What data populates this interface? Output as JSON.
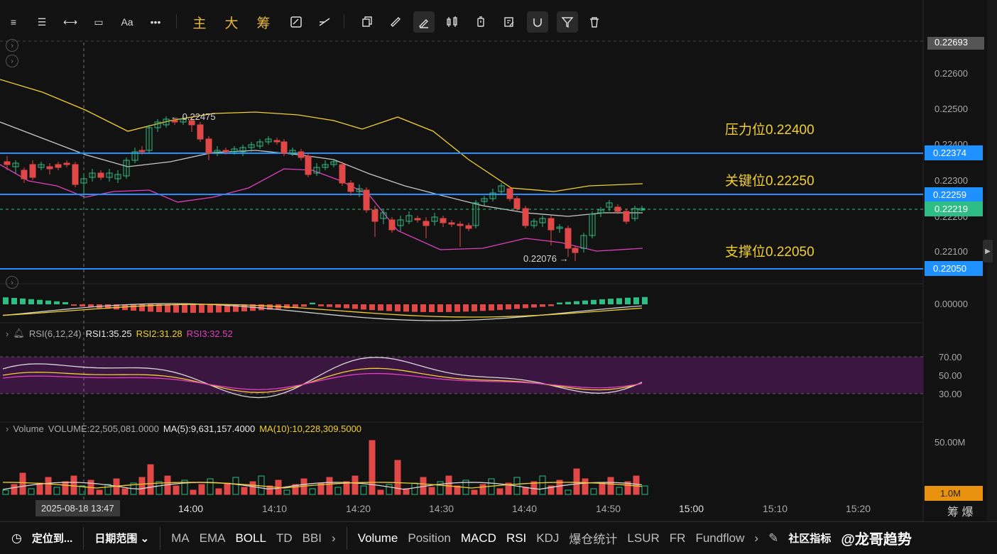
{
  "toolbar": {
    "items": [
      "≡",
      "☰",
      "⟷",
      "▭",
      "Aa",
      "•••"
    ],
    "cn": [
      "主",
      "大",
      "筹"
    ]
  },
  "price_axis": {
    "labels": [
      "0.22600",
      "0.22500",
      "0.22400",
      "0.22300",
      "0.22200",
      "0.22100"
    ],
    "top_tag": "0.22693",
    "macd_zero": "0.00000",
    "rsi_labels": [
      "70.00",
      "50.00",
      "30.00"
    ],
    "vol_top": "50.00M",
    "vol_tag": "1.0M"
  },
  "price_tags": {
    "resistance_line": "0.22374",
    "key_line": "0.22259",
    "current": "0.22219",
    "support_line": "0.22050"
  },
  "annotations": {
    "resistance": "压力位0.22400",
    "key": "关键位0.22250",
    "support": "支撑位0.22050",
    "high": "← 0.22475",
    "low": "0.22076 →"
  },
  "rsi_legend": {
    "name": "RSI(6,12,24)",
    "rsi1": "RSI1:35.25",
    "rsi2": "RSI2:31.28",
    "rsi3": "RSI3:32.52"
  },
  "volume_legend": {
    "name": "Volume",
    "volume": "VOLUME:22,505,081.0000",
    "ma5": "MA(5):9,631,157.4000",
    "ma10": "MA(10):10,228,309.5000"
  },
  "time_axis": {
    "cursor": "2025-08-18 13:47",
    "labels": [
      "14:00",
      "14:10",
      "14:20",
      "14:30",
      "14:40",
      "14:50",
      "15:00",
      "15:10",
      "15:20"
    ],
    "right_cn": "筹 爆"
  },
  "bottom_bar": {
    "locate": "定位到...",
    "date_range": "日期范围 ⌄",
    "main_indicators": [
      "MA",
      "EMA",
      "BOLL",
      "TD",
      "BBI"
    ],
    "sub_indicators": [
      "Volume",
      "Position",
      "MACD",
      "RSI",
      "KDJ",
      "爆仓统计",
      "LSUR",
      "FR",
      "Fundflow"
    ],
    "community": "社区指标",
    "watermark": "@龙哥趋势"
  },
  "colors": {
    "up": "#2ebd85",
    "down": "#e04848",
    "boll_upper": "#f2d02e",
    "boll_mid": "#c8c8c8",
    "boll_lower": "#e040c0",
    "level_line": "#1e90ff",
    "rsi_band": "#3a1640"
  }
}
